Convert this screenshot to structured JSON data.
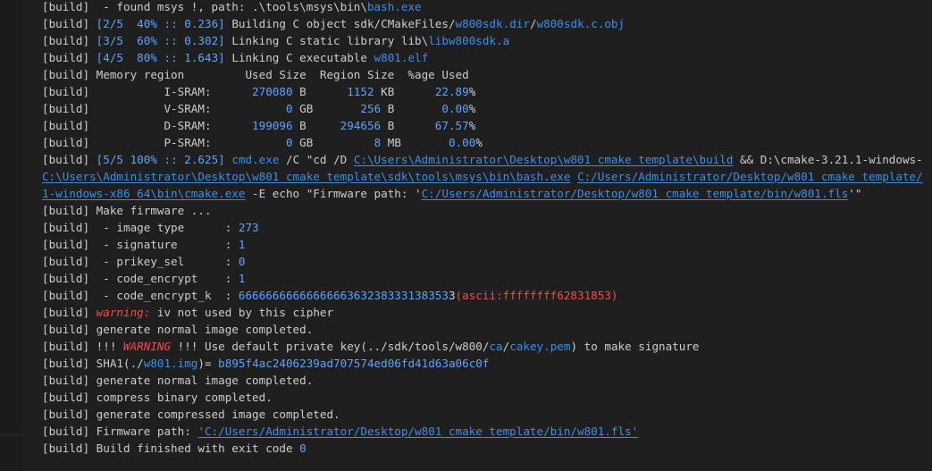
{
  "terminal": {
    "lines": [
      {
        "segs": [
          {
            "t": "[build]  - found msys !, path: .\\tools\\msys\\bin\\"
          },
          {
            "t": "bash.exe",
            "c": "b"
          }
        ]
      },
      {
        "segs": [
          {
            "t": "[build] "
          },
          {
            "t": "[2/5  40% :: 0.236]",
            "c": "n"
          },
          {
            "t": " Building C object sdk/CMakeFiles/"
          },
          {
            "t": "w800sdk.dir",
            "c": "b"
          },
          {
            "t": "/"
          },
          {
            "t": "w800sdk.c.obj",
            "c": "b"
          }
        ]
      },
      {
        "segs": [
          {
            "t": "[build] "
          },
          {
            "t": "[3/5  60% :: 0.302]",
            "c": "n"
          },
          {
            "t": " Linking C static library lib\\"
          },
          {
            "t": "libw800sdk.a",
            "c": "b"
          }
        ]
      },
      {
        "segs": [
          {
            "t": "[build] "
          },
          {
            "t": "[4/5  80% :: 1.643]",
            "c": "n"
          },
          {
            "t": " Linking C executable "
          },
          {
            "t": "w801.elf",
            "c": "b"
          }
        ]
      },
      {
        "segs": [
          {
            "t": "[build] Memory region         Used Size  Region Size  %age Used"
          }
        ]
      },
      {
        "segs": [
          {
            "t": "[build]           I-SRAM:      "
          },
          {
            "t": "270080",
            "c": "n"
          },
          {
            "t": " B      "
          },
          {
            "t": "1152",
            "c": "n"
          },
          {
            "t": " KB      "
          },
          {
            "t": "22.89",
            "c": "n"
          },
          {
            "t": "%"
          }
        ]
      },
      {
        "segs": [
          {
            "t": "[build]           V-SRAM:           "
          },
          {
            "t": "0",
            "c": "n"
          },
          {
            "t": " GB       "
          },
          {
            "t": "256",
            "c": "n"
          },
          {
            "t": " B       "
          },
          {
            "t": "0.00",
            "c": "n"
          },
          {
            "t": "%"
          }
        ]
      },
      {
        "segs": [
          {
            "t": "[build]           D-SRAM:      "
          },
          {
            "t": "199096",
            "c": "n"
          },
          {
            "t": " B     "
          },
          {
            "t": "294656",
            "c": "n"
          },
          {
            "t": " B      "
          },
          {
            "t": "67.57",
            "c": "n"
          },
          {
            "t": "%"
          }
        ]
      },
      {
        "segs": [
          {
            "t": "[build]           P-SRAM:           "
          },
          {
            "t": "0",
            "c": "n"
          },
          {
            "t": " GB         "
          },
          {
            "t": "8",
            "c": "n"
          },
          {
            "t": " MB       "
          },
          {
            "t": "0.00",
            "c": "n"
          },
          {
            "t": "%"
          }
        ]
      },
      {
        "segs": [
          {
            "t": "[build] "
          },
          {
            "t": "[5/5 100% :: 2.625]",
            "c": "n"
          },
          {
            "t": " "
          },
          {
            "t": "cmd.exe",
            "c": "b"
          },
          {
            "t": " /C \"cd /D "
          },
          {
            "t": "C:\\Users\\Administrator\\Desktop\\w801_cmake_template\\build",
            "c": "l"
          },
          {
            "t": " && D:\\cmake-3.21.1-windows-"
          }
        ]
      },
      {
        "segs": [
          {
            "t": "C:\\Users\\Administrator\\Desktop\\w801_cmake_template\\sdk\\tools\\msys\\bin\\bash.exe",
            "c": "l"
          },
          {
            "t": " "
          },
          {
            "t": "C:/Users/Administrator/Desktop/w801_cmake_template/",
            "c": "l"
          }
        ]
      },
      {
        "segs": [
          {
            "t": "1-windows-x86_64\\bin\\cmake.exe",
            "c": "l"
          },
          {
            "t": " -E echo \"Firmware path: '"
          },
          {
            "t": "C:/Users/Administrator/Desktop/w801_cmake_template/bin/w801.fls",
            "c": "l"
          },
          {
            "t": "'\""
          }
        ]
      },
      {
        "segs": [
          {
            "t": "[build] Make firmware ..."
          }
        ]
      },
      {
        "segs": [
          {
            "t": "[build]  - image type      : "
          },
          {
            "t": "273",
            "c": "n"
          }
        ]
      },
      {
        "segs": [
          {
            "t": "[build]  - signature       : "
          },
          {
            "t": "1",
            "c": "n"
          }
        ]
      },
      {
        "segs": [
          {
            "t": "[build]  - prikey_sel      : "
          },
          {
            "t": "0",
            "c": "n"
          }
        ]
      },
      {
        "segs": [
          {
            "t": "[build]  - code_encrypt    : "
          },
          {
            "t": "1",
            "c": "n"
          }
        ]
      },
      {
        "segs": [
          {
            "t": "[build]  - code_encrypt_k  : "
          },
          {
            "t": "6666666666666666363238333138353",
            "c": "n"
          },
          {
            "t": "3"
          },
          {
            "t": "(ascii:ffffffff62831853)",
            "c": "r"
          }
        ]
      },
      {
        "segs": [
          {
            "t": "[build] "
          },
          {
            "t": "warning:",
            "c": "w"
          },
          {
            "t": " iv not used by this cipher"
          }
        ]
      },
      {
        "segs": [
          {
            "t": "[build] generate normal image completed."
          }
        ]
      },
      {
        "segs": [
          {
            "t": "[build] !!! "
          },
          {
            "t": "WARNING",
            "c": "w"
          },
          {
            "t": " !!! Use default private key(../sdk/tools/w800/"
          },
          {
            "t": "ca",
            "c": "b"
          },
          {
            "t": "/"
          },
          {
            "t": "cakey.pem",
            "c": "b"
          },
          {
            "t": ") to make signature"
          }
        ]
      },
      {
        "segs": [
          {
            "t": "[build] SHA1(./"
          },
          {
            "t": "w801.img",
            "c": "b"
          },
          {
            "t": ")= "
          },
          {
            "t": "b895f4ac2406239ad707574ed06fd41d63a06c0f",
            "c": "n"
          }
        ]
      },
      {
        "segs": [
          {
            "t": "[build] generate normal image completed."
          }
        ]
      },
      {
        "segs": [
          {
            "t": "[build] compress binary completed."
          }
        ]
      },
      {
        "segs": [
          {
            "t": "[build] generate compressed image completed."
          }
        ]
      },
      {
        "segs": [
          {
            "t": "[build] Firmware path: "
          },
          {
            "t": "'C:/Users/Administrator/Desktop/w801_cmake_template/bin/w801.fls'",
            "c": "l"
          }
        ]
      },
      {
        "segs": [
          {
            "t": "[build] Build finished with exit code "
          },
          {
            "t": "0",
            "c": "n"
          }
        ]
      }
    ]
  }
}
